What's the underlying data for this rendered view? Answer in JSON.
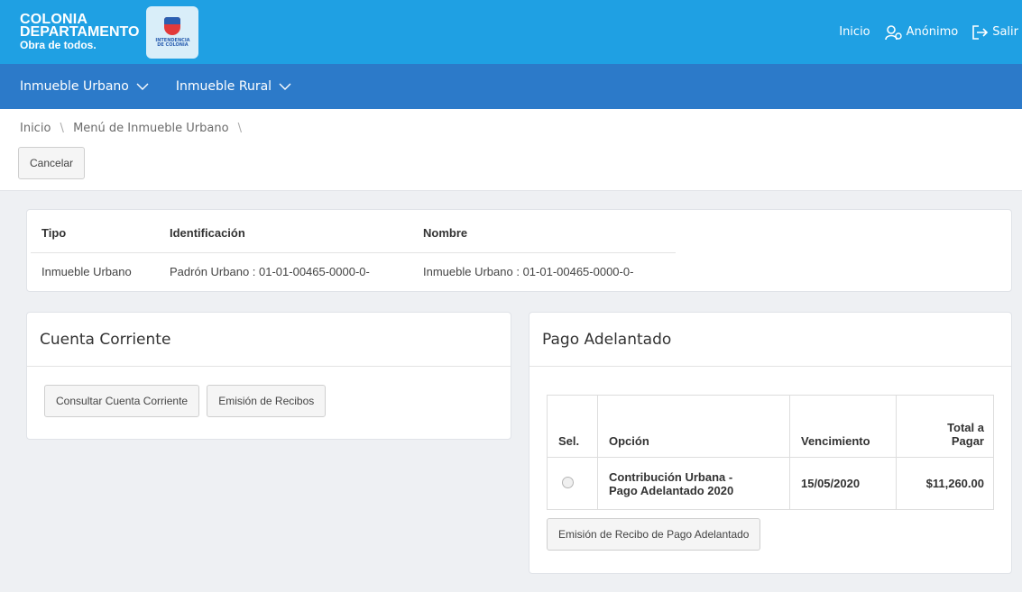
{
  "brand": {
    "line1": "COLONIA",
    "line2": "DEPARTAMENTO",
    "line3": "Obra de todos.",
    "logo_text1": "INTENDENCIA",
    "logo_text2": "DE COLONIA"
  },
  "top_links": {
    "inicio": "Inicio",
    "user": "Anónimo",
    "salir": "Salir"
  },
  "nav": [
    {
      "label": "Inmueble Urbano"
    },
    {
      "label": "Inmueble Rural"
    }
  ],
  "breadcrumb": [
    "Inicio",
    "Menú de Inmueble Urbano"
  ],
  "toolbar": {
    "cancel_label": "Cancelar"
  },
  "info_table": {
    "headers": [
      "Tipo",
      "Identificación",
      "Nombre"
    ],
    "row": [
      "Inmueble Urbano",
      "Padrón Urbano : 01-01-00465-0000-0-",
      "Inmueble Urbano : 01-01-00465-0000-0-"
    ]
  },
  "cuenta_corriente": {
    "title": "Cuenta Corriente",
    "btn_consultar": "Consultar Cuenta Corriente",
    "btn_emision": "Emisión de Recibos"
  },
  "pago_adelantado": {
    "title": "Pago Adelantado",
    "headers": {
      "sel": "Sel.",
      "opcion": "Opción",
      "vencimiento": "Vencimiento",
      "total_1": "Total a",
      "total_2": "Pagar"
    },
    "row": {
      "opcion_1": "Contribución Urbana -",
      "opcion_2": "Pago Adelantado 2020",
      "vencimiento": "15/05/2020",
      "total": "$11,260.00",
      "selected": false
    },
    "btn_emision": "Emisión de Recibo de Pago Adelantado"
  },
  "colors": {
    "header": "#1fa0e3",
    "navbar": "#2c7ac9"
  }
}
